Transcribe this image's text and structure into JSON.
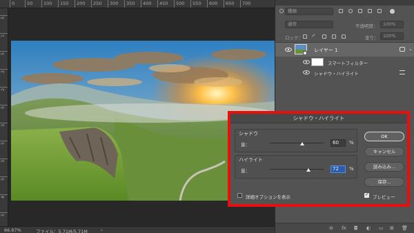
{
  "rulers": {
    "top_ticks": [
      "0",
      "50",
      "100",
      "150",
      "200",
      "250",
      "300",
      "350",
      "400",
      "450",
      "500",
      "550",
      "600",
      "650",
      "700"
    ],
    "left_ticks": [
      "5",
      "1",
      "5",
      "2",
      "2",
      "5",
      "3",
      "5",
      "3",
      "5",
      "4",
      "5"
    ]
  },
  "statusbar": {
    "zoom": "66.67%",
    "file_info": "ファイル：5.71M/5.71M",
    "arrow": "›"
  },
  "layers_panel": {
    "filter_placeholder": "種類",
    "blend_mode": "通常",
    "opacity_label": "不透明度：",
    "opacity_value": "100%",
    "lock_label": "ロック：",
    "fill_label": "塗り：",
    "fill_value": "100%",
    "layer_name": "レイヤー 1",
    "smart_filter_label": "スマートフィルター",
    "filter_name": "シャドウ・ハイライト"
  },
  "dialog": {
    "title": "シャドウ・ハイライト",
    "shadows": {
      "label": "シャドウ",
      "amount_label": "量：",
      "value": "60",
      "unit": "%",
      "level": 0.6
    },
    "highlights": {
      "label": "ハイライト",
      "amount_label": "量：",
      "value": "72",
      "unit": "%",
      "level": 0.72
    },
    "buttons": {
      "ok": "OK",
      "cancel": "キャンセル",
      "load": "読み込み...",
      "save": "保存..."
    },
    "show_more_options": "詳細オプションを表示",
    "show_more_options_checked": false,
    "preview": "プレビュー",
    "preview_checked": true
  },
  "colors": {
    "highlight_border": "#e8100f",
    "focus_blue": "#2d5ca8"
  }
}
